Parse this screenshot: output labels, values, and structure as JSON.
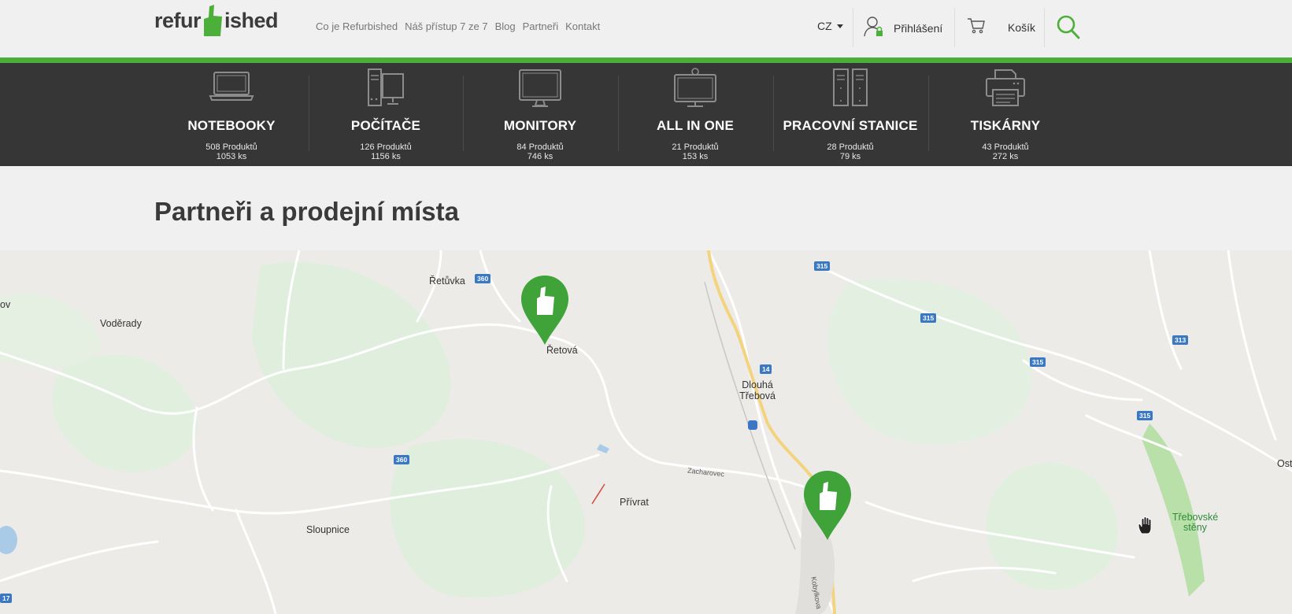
{
  "header": {
    "logo_text_left": "refur",
    "logo_text_right": "ished",
    "nav": [
      "Co je Refurbished",
      "Náš přístup 7 ze 7",
      "Blog",
      "Partneři",
      "Kontakt"
    ],
    "language": "CZ",
    "login_label": "Přihlášení",
    "cart_label": "Košík"
  },
  "colors": {
    "brand_green": "#4caf3a",
    "category_bar": "#363636"
  },
  "categories": [
    {
      "name": "NOTEBOOKY",
      "products": "508 Produktů",
      "pieces": "1053 ks",
      "icon": "laptop-icon"
    },
    {
      "name": "POČÍTAČE",
      "products": "126 Produktů",
      "pieces": "1156 ks",
      "icon": "desktop-computer-icon"
    },
    {
      "name": "MONITORY",
      "products": "84 Produktů",
      "pieces": "746 ks",
      "icon": "monitor-icon"
    },
    {
      "name": "ALL IN ONE",
      "products": "21 Produktů",
      "pieces": "153 ks",
      "icon": "all-in-one-icon"
    },
    {
      "name": "PRACOVNÍ STANICE",
      "products": "28 Produktů",
      "pieces": "79 ks",
      "icon": "workstation-icon"
    },
    {
      "name": "TISKÁRNY",
      "products": "43 Produktů",
      "pieces": "272 ks",
      "icon": "printer-icon"
    }
  ],
  "page_title": "Partneři a prodejní místa",
  "map": {
    "places": [
      "Řetůvka",
      "Voděrady",
      "Řetová",
      "Dlouhá Třebová",
      "Přívrat",
      "Sloupnice",
      "Zacharovec",
      "Třebovské stěny",
      "Ost",
      "ov",
      "Kobylkova"
    ],
    "road_numbers": [
      "360",
      "360",
      "315",
      "315",
      "315",
      "315",
      "313",
      "14",
      "17"
    ]
  }
}
